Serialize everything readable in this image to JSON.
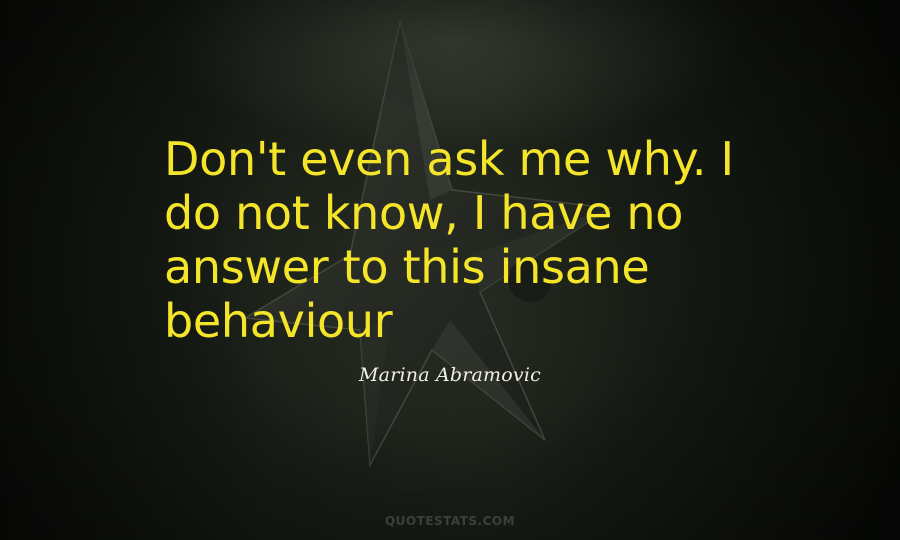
{
  "quote": {
    "lines": [
      "Don't even ask me why. I",
      "do not know, I have no",
      "answer to this insane",
      "behaviour"
    ],
    "author": "Marina Abramovic"
  },
  "watermark": "QUOTESTATS.COM",
  "colors": {
    "quote_text": "#f4e52a",
    "author_text": "#f2f0e2",
    "background": "#121510"
  }
}
